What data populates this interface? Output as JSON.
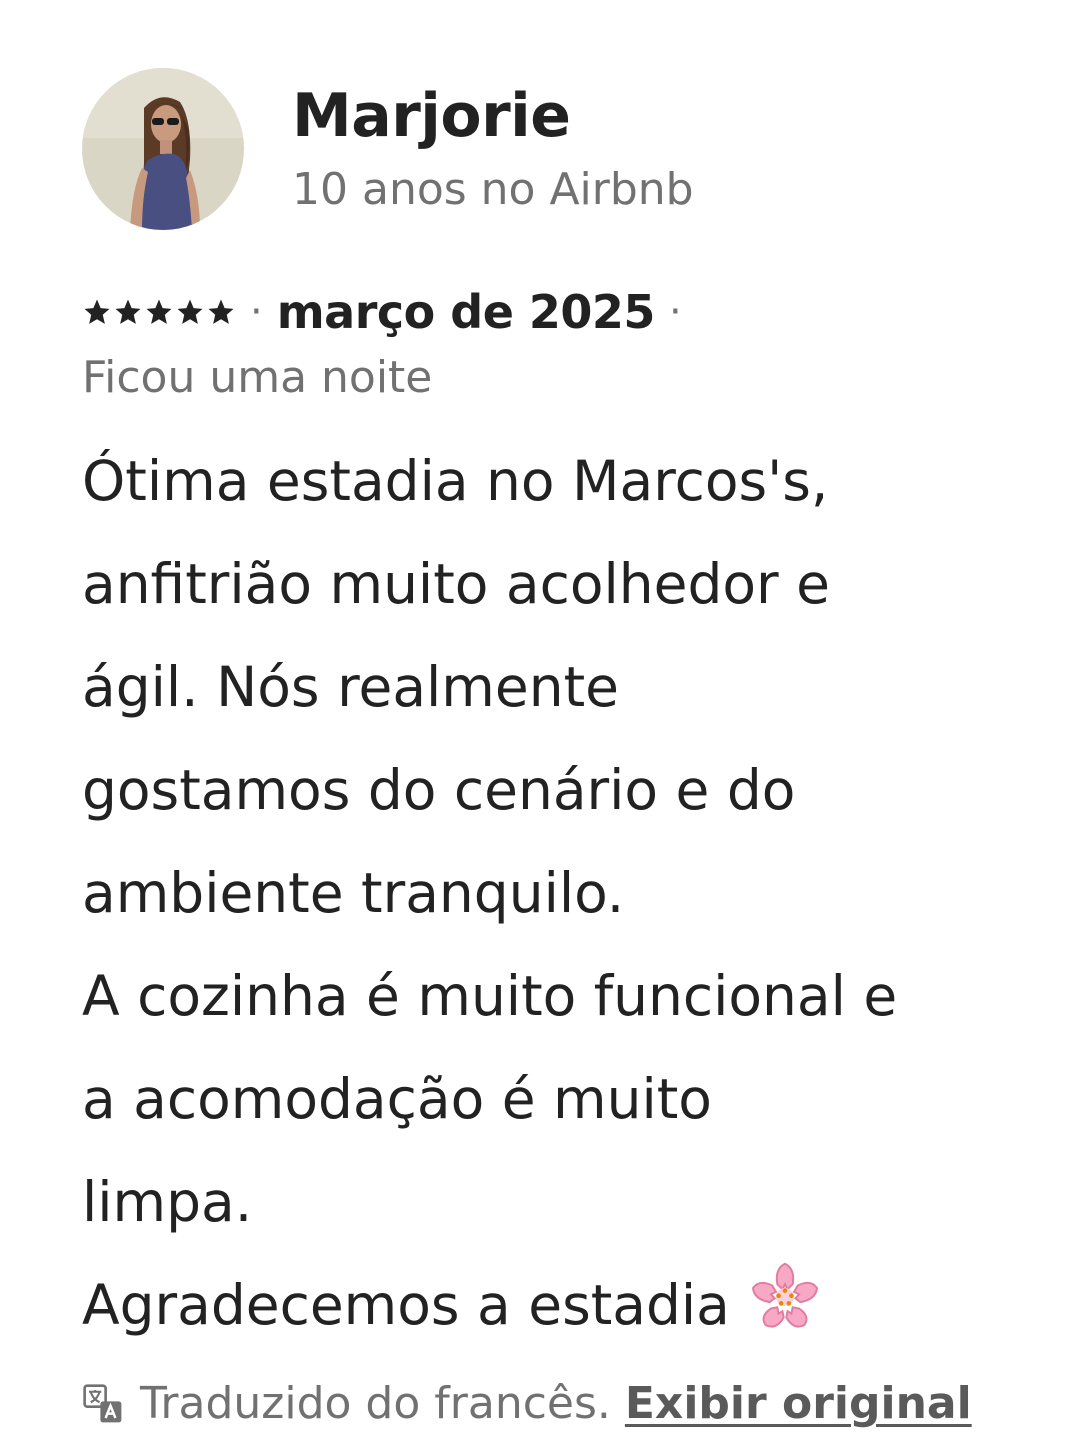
{
  "review": {
    "reviewer_name": "Marjorie",
    "tenure": "10 anos no Airbnb",
    "rating": 5,
    "rating_display": "★★★★★",
    "separator": "·",
    "date": "março de 2025",
    "stay_length": "Ficou uma noite",
    "text": "Ótima estadia no Marcos's,\nanfitrião muito acolhedor e\nágil. Nós realmente\ngostamos do cenário e do\nambiente tranquilo.\nA cozinha é muito funcional e\na acomodação é muito\nlimpa.\nAgradecemos a estadia",
    "emoji": "cherry-blossom",
    "avatar_icon": "reviewer-photo"
  },
  "translation": {
    "icon": "translate-icon",
    "note": "Traduzido do francês.",
    "show_original_label": "Exibir original"
  },
  "colors": {
    "primary_text": "#222222",
    "secondary_text": "#717171"
  }
}
